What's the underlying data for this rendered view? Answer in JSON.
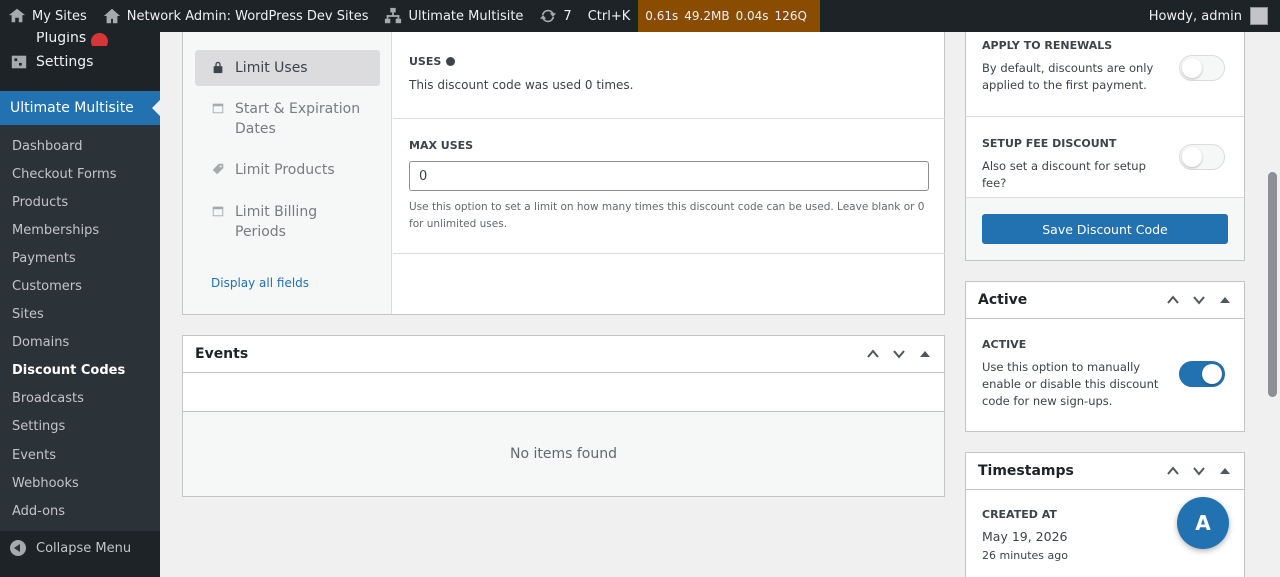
{
  "adminbar": {
    "my_sites": "My Sites",
    "network_admin": "Network Admin: WordPress Dev Sites",
    "ultimate_multisite": "Ultimate Multisite",
    "updates_count": "7",
    "shortcut": "Ctrl+K",
    "qm": {
      "time": "0.61s",
      "memory": "49.2MB",
      "db_time": "0.04s",
      "queries": "126Q"
    },
    "howdy": "Howdy, admin"
  },
  "sidebar": {
    "plugins_label": "Plugins",
    "settings_label": "Settings",
    "current_label": "Ultimate Multisite",
    "submenu": [
      "Dashboard",
      "Checkout Forms",
      "Products",
      "Memberships",
      "Payments",
      "Customers",
      "Sites",
      "Domains",
      "Discount Codes",
      "Broadcasts",
      "Settings",
      "Events",
      "Webhooks",
      "Add-ons"
    ],
    "active_index": 8,
    "collapse_label": "Collapse Menu"
  },
  "limits": {
    "tabs": [
      {
        "label": "Limit Uses",
        "icon": "lock-icon"
      },
      {
        "label": "Start & Expiration Dates",
        "icon": "calendar-icon"
      },
      {
        "label": "Limit Products",
        "icon": "tag-icon"
      },
      {
        "label": "Limit Billing Periods",
        "icon": "calendar-icon"
      }
    ],
    "display_all": "Display all fields",
    "uses_label": "USES",
    "uses_text": "This discount code was used 0 times.",
    "max_uses_label": "MAX USES",
    "max_uses_value": "0",
    "max_uses_desc": "Use this option to set a limit on how many times this discount code can be used. Leave blank or 0 for unlimited uses."
  },
  "events": {
    "title": "Events",
    "empty": "No items found"
  },
  "save_box": {
    "renewals_label": "APPLY TO RENEWALS",
    "renewals_desc": "By default, discounts are only applied to the first payment.",
    "renewals_on": false,
    "setup_fee_label": "SETUP FEE DISCOUNT",
    "setup_fee_desc": "Also set a discount for setup fee?",
    "setup_fee_on": false,
    "save_label": "Save Discount Code"
  },
  "active_box": {
    "title": "Active",
    "label": "ACTIVE",
    "desc": "Use this option to manually enable or disable this discount code for new sign-ups.",
    "on": true
  },
  "timestamps_box": {
    "title": "Timestamps",
    "created_label": "CREATED AT",
    "created_value": "May 19, 2026",
    "created_ago": "26 minutes ago"
  },
  "fab_label": "A",
  "colors": {
    "accent": "#2271b1",
    "adminbar": "#1d2327",
    "qm": "#8a4c00"
  }
}
